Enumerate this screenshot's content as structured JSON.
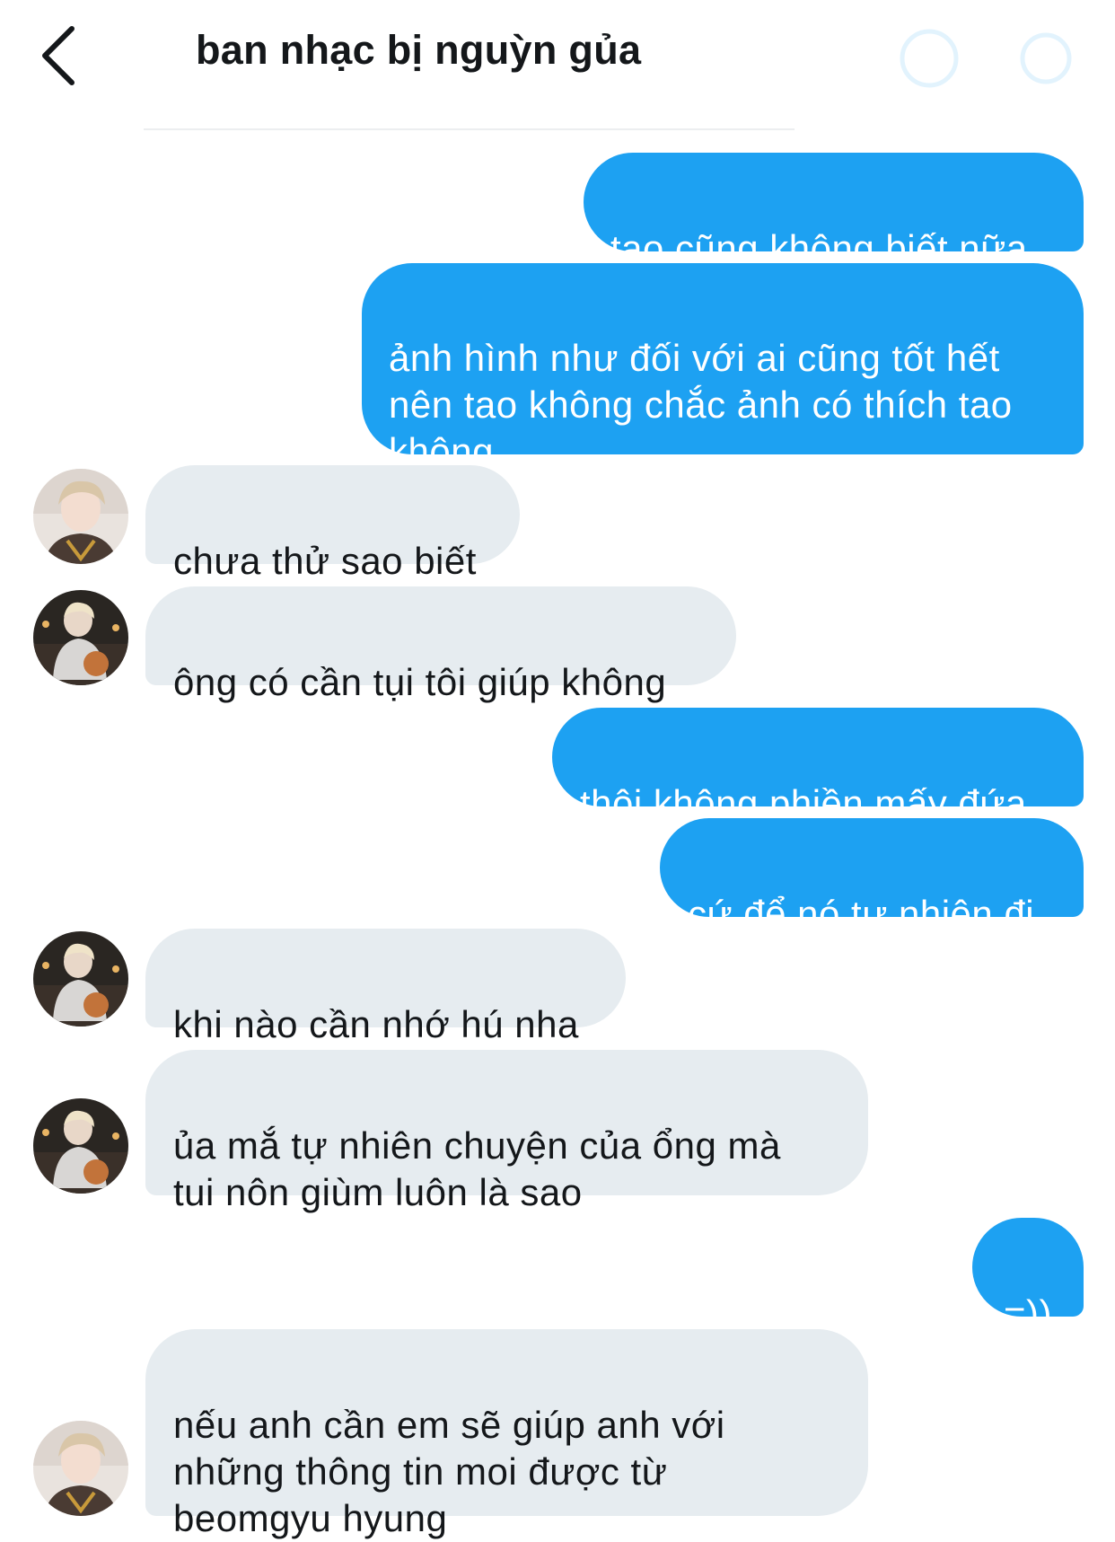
{
  "header": {
    "title": "ban nhạc bị nguỳn gủa",
    "back_icon": "chevron-left-icon",
    "right_icons": [
      "info-icon",
      "settings-icon"
    ]
  },
  "colors": {
    "outgoing_bubble": "#1da1f2",
    "incoming_bubble": "#e6ecf0",
    "text": "#14171a"
  },
  "messages": [
    {
      "side": "out",
      "text": "tao cũng không biết nữa"
    },
    {
      "side": "out",
      "text": "ảnh hình như đối với ai cũng tốt hết\nnên tao không chắc ảnh có thích tao\nkhông"
    },
    {
      "side": "in",
      "avatar": "avatar-a",
      "text": "chưa thử sao biết"
    },
    {
      "side": "in",
      "avatar": "avatar-b",
      "text": "ông có cần tụi tôi giúp không"
    },
    {
      "side": "out",
      "text": "thôi không phiền mấy đứa"
    },
    {
      "side": "out",
      "text": "cứ để nó tự nhiên đi"
    },
    {
      "side": "in",
      "avatar": "avatar-b",
      "text": "khi nào cần nhớ hú nha"
    },
    {
      "side": "in",
      "avatar": "avatar-b",
      "text": "ủa mắ tự nhiên chuyện của ổng mà\ntui nôn giùm luôn là sao"
    },
    {
      "side": "out",
      "text": "=))"
    },
    {
      "side": "in",
      "avatar": "avatar-a",
      "text": "nếu anh cần em sẽ giúp anh với\nnhững thông tin moi được từ\nbeomgyu hyung"
    }
  ]
}
